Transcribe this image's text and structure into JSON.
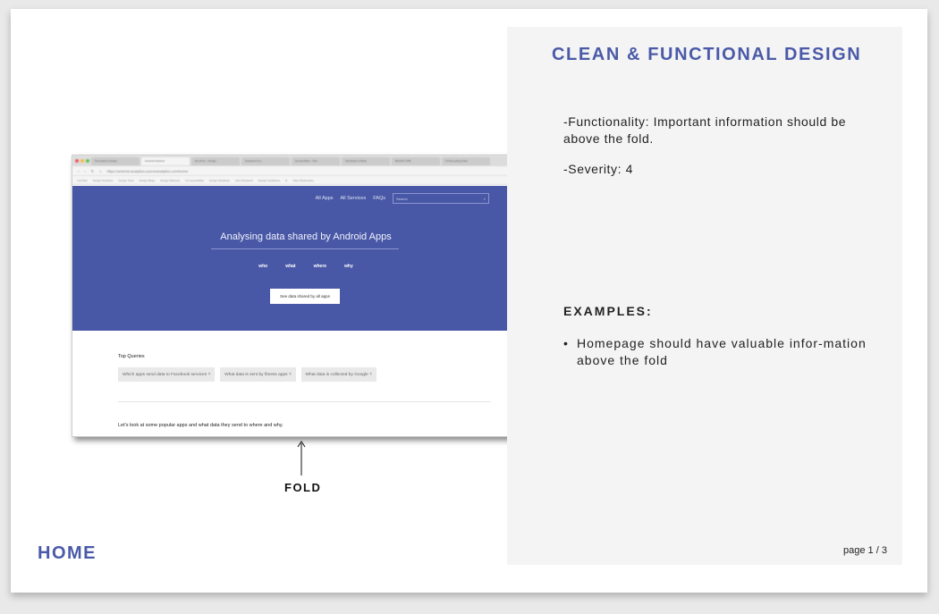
{
  "panel": {
    "title": "CLEAN & FUNCTIONAL DESIGN",
    "functionality": "-Functionality: Important information should be above the fold.",
    "severity": "-Severity: 4",
    "examples_title": "EXAMPLES:",
    "examples": [
      "Homepage should have valuable infor-mation above the fold"
    ],
    "page_label": "page 1 / 3"
  },
  "slide": {
    "home_label": "HOME",
    "fold_label": "FOLD"
  },
  "screenshot": {
    "tabs": [
      "Persuasive Design",
      "Android Network",
      "My Drive - Design",
      "Questions for...",
      "DuncanMam - Rev",
      "Alphatrak & Alpha",
      "BIHVM LIMB",
      "IS Recording Data"
    ],
    "url": "https://android-analytics.sourceanalytics.com/home",
    "bookmarks": [
      "YouTube",
      "Design Portfolios",
      "Design Tools",
      "Design Blogs",
      "Design Methods",
      "UX accessibility",
      "Design Readings",
      "User Research",
      "Design Guidelines",
      "E",
      "Other Bookmarks"
    ],
    "nav": [
      "All Apps",
      "All Services",
      "FAQs"
    ],
    "search_placeholder": "Search",
    "hero_title": "Analysing data shared by Android Apps",
    "hero_words": [
      "who",
      "what",
      "where",
      "why"
    ],
    "cta_label": "See data shared by all apps",
    "top_queries_title": "Top Queries",
    "queries": [
      "Which apps send data to Facebook services ?",
      "What data is sent by fitness apps ?",
      "What data is collected by Google ?"
    ],
    "popular_text": "Let's look at some popular apps and what data they send to where and why."
  },
  "colors": {
    "accent": "#4a5aa8",
    "hero_bg": "#4958a6",
    "panel_bg": "#f4f4f4"
  }
}
